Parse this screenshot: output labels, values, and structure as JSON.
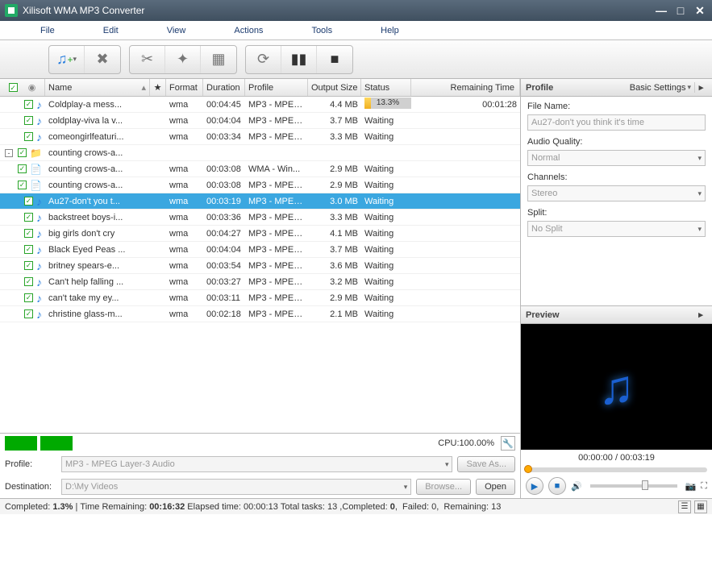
{
  "window": {
    "title": "Xilisoft WMA MP3 Converter"
  },
  "menu": {
    "file": "File",
    "edit": "Edit",
    "view": "View",
    "actions": "Actions",
    "tools": "Tools",
    "help": "Help"
  },
  "columns": {
    "name": "Name",
    "star": "★",
    "format": "Format",
    "duration": "Duration",
    "profile": "Profile",
    "output": "Output Size",
    "status": "Status",
    "remain": "Remaining Time"
  },
  "rows": [
    {
      "indent": 0,
      "icon": "note",
      "name": "Coldplay-a mess...",
      "format": "wma",
      "duration": "00:04:45",
      "profile": "MP3 - MPEG...",
      "output": "4.4 MB",
      "status_type": "progress",
      "progress_pct": 13.3,
      "progress_text": "13.3%",
      "remain": "00:01:28"
    },
    {
      "indent": 0,
      "icon": "note",
      "name": "coldplay-viva la v...",
      "format": "wma",
      "duration": "00:04:04",
      "profile": "MP3 - MPEG...",
      "output": "3.7 MB",
      "status_type": "text",
      "status": "Waiting",
      "remain": ""
    },
    {
      "indent": 0,
      "icon": "note",
      "name": "comeongirlfeaturi...",
      "format": "wma",
      "duration": "00:03:34",
      "profile": "MP3 - MPEG...",
      "output": "3.3 MB",
      "status_type": "text",
      "status": "Waiting",
      "remain": ""
    },
    {
      "indent": 0,
      "icon": "folder",
      "toggle": "-",
      "name": "counting crows-a...",
      "format": "",
      "duration": "",
      "profile": "",
      "output": "",
      "status_type": "none",
      "status": "",
      "remain": ""
    },
    {
      "indent": 1,
      "icon": "doc",
      "name": "counting crows-a...",
      "format": "wma",
      "duration": "00:03:08",
      "profile": "WMA - Win...",
      "output": "2.9 MB",
      "status_type": "text",
      "status": "Waiting",
      "remain": ""
    },
    {
      "indent": 1,
      "icon": "doc",
      "name": "counting crows-a...",
      "format": "wma",
      "duration": "00:03:08",
      "profile": "MP3 - MPEG...",
      "output": "2.9 MB",
      "status_type": "text",
      "status": "Waiting",
      "remain": ""
    },
    {
      "indent": 0,
      "icon": "note",
      "selected": true,
      "name": "Au27-don't you t...",
      "format": "wma",
      "duration": "00:03:19",
      "profile": "MP3 - MPEG...",
      "output": "3.0 MB",
      "status_type": "text",
      "status": "Waiting",
      "remain": ""
    },
    {
      "indent": 0,
      "icon": "note",
      "name": "backstreet boys-i...",
      "format": "wma",
      "duration": "00:03:36",
      "profile": "MP3 - MPEG...",
      "output": "3.3 MB",
      "status_type": "text",
      "status": "Waiting",
      "remain": ""
    },
    {
      "indent": 0,
      "icon": "note",
      "name": "big girls don't cry",
      "format": "wma",
      "duration": "00:04:27",
      "profile": "MP3 - MPEG...",
      "output": "4.1 MB",
      "status_type": "text",
      "status": "Waiting",
      "remain": ""
    },
    {
      "indent": 0,
      "icon": "note",
      "name": "Black Eyed Peas ...",
      "format": "wma",
      "duration": "00:04:04",
      "profile": "MP3 - MPEG...",
      "output": "3.7 MB",
      "status_type": "text",
      "status": "Waiting",
      "remain": ""
    },
    {
      "indent": 0,
      "icon": "note",
      "name": "britney spears-e...",
      "format": "wma",
      "duration": "00:03:54",
      "profile": "MP3 - MPEG...",
      "output": "3.6 MB",
      "status_type": "text",
      "status": "Waiting",
      "remain": ""
    },
    {
      "indent": 0,
      "icon": "note",
      "name": "Can't help falling ...",
      "format": "wma",
      "duration": "00:03:27",
      "profile": "MP3 - MPEG...",
      "output": "3.2 MB",
      "status_type": "text",
      "status": "Waiting",
      "remain": ""
    },
    {
      "indent": 0,
      "icon": "note",
      "name": "can't take my ey...",
      "format": "wma",
      "duration": "00:03:11",
      "profile": "MP3 - MPEG...",
      "output": "2.9 MB",
      "status_type": "text",
      "status": "Waiting",
      "remain": ""
    },
    {
      "indent": 0,
      "icon": "note",
      "name": "christine glass-m...",
      "format": "wma",
      "duration": "00:02:18",
      "profile": "MP3 - MPEG...",
      "output": "2.1 MB",
      "status_type": "text",
      "status": "Waiting",
      "remain": ""
    }
  ],
  "profilePanel": {
    "title": "Profile",
    "basicSettings": "Basic Settings",
    "fileNameLabel": "File Name:",
    "fileName": "Au27-don't you think it's time",
    "audioQualityLabel": "Audio Quality:",
    "audioQuality": "Normal",
    "channelsLabel": "Channels:",
    "channels": "Stereo",
    "splitLabel": "Split:",
    "split": "No Split"
  },
  "preview": {
    "title": "Preview",
    "time": "00:00:00 / 00:03:19"
  },
  "cpu": {
    "text": "CPU:100.00%"
  },
  "bottom": {
    "profileLabel": "Profile:",
    "profileValue": "MP3 - MPEG Layer-3 Audio",
    "saveAs": "Save As...",
    "destLabel": "Destination:",
    "destValue": "D:\\My Videos",
    "browse": "Browse...",
    "open": "Open"
  },
  "status": {
    "completedLabel": "Completed:",
    "completedPct": "1.3%",
    "timeRemainLabel": "Time Remaining:",
    "timeRemain": "00:16:32",
    "elapsedLabel": "Elapsed time:",
    "elapsed": "00:00:13",
    "totalLabel": "Total tasks:",
    "total": "13",
    "compLabel": "Completed:",
    "comp": "0",
    "failLabel": "Failed:",
    "fail": "0",
    "remainLabel": "Remaining:",
    "remain": "13"
  }
}
